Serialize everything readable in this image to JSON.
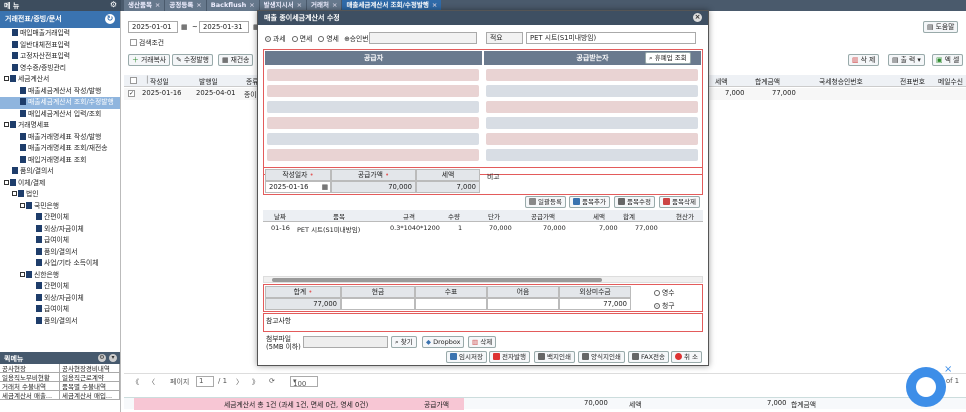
{
  "app": {
    "menu_label": "메 뉴"
  },
  "tabs": [
    {
      "label": "생산품목"
    },
    {
      "label": "공정등록"
    },
    {
      "label": "Backflush"
    },
    {
      "label": "발생지시서"
    },
    {
      "label": "거래처"
    },
    {
      "label": "매출세금계산서 조회/수정발행"
    }
  ],
  "sidebar": {
    "section_title": "거래전표/증빙/문서",
    "items": [
      {
        "label": "매입매출거래입력",
        "indent": 1,
        "icon": "doc"
      },
      {
        "label": "일반대체전표입력",
        "indent": 1,
        "icon": "doc"
      },
      {
        "label": "고정자산전표입력",
        "indent": 1,
        "icon": "doc"
      },
      {
        "label": "영수증/증빙관리",
        "indent": 1,
        "icon": "doc"
      },
      {
        "label": "세금계산서",
        "indent": 0,
        "icon": "fold"
      },
      {
        "label": "매출세금계산서 작성/발행",
        "indent": 2,
        "icon": "doc"
      },
      {
        "label": "매출세금계산서 조회/수정발행",
        "indent": 2,
        "icon": "doc",
        "selected": true
      },
      {
        "label": "매입세금계산서 입력/조회",
        "indent": 2,
        "icon": "doc"
      },
      {
        "label": "거래명세표",
        "indent": 0,
        "icon": "fold"
      },
      {
        "label": "매출거래명세표 작성/발행",
        "indent": 2,
        "icon": "doc"
      },
      {
        "label": "매출거래명세표 조회/재전송",
        "indent": 2,
        "icon": "doc"
      },
      {
        "label": "매입거래명세표 조회",
        "indent": 2,
        "icon": "doc"
      },
      {
        "label": "품의/결의서",
        "indent": 1,
        "icon": "doc"
      },
      {
        "label": "이체/결제",
        "indent": 0,
        "icon": "fold"
      },
      {
        "label": "법인",
        "indent": 1,
        "icon": "fold"
      },
      {
        "label": "국민은행",
        "indent": 2,
        "icon": "fold"
      },
      {
        "label": "간편이체",
        "indent": 4,
        "icon": "doc"
      },
      {
        "label": "외상/자금이체",
        "indent": 4,
        "icon": "doc"
      },
      {
        "label": "급여이체",
        "indent": 4,
        "icon": "doc"
      },
      {
        "label": "품의/결의서",
        "indent": 4,
        "icon": "doc"
      },
      {
        "label": "사업/기타 소득이체",
        "indent": 4,
        "icon": "doc"
      },
      {
        "label": "신한은행",
        "indent": 2,
        "icon": "fold"
      },
      {
        "label": "간편이체",
        "indent": 4,
        "icon": "doc"
      },
      {
        "label": "외상/자금이체",
        "indent": 4,
        "icon": "doc"
      },
      {
        "label": "급여이체",
        "indent": 4,
        "icon": "doc"
      },
      {
        "label": "품의/결의서",
        "indent": 4,
        "icon": "doc"
      }
    ]
  },
  "quickbar": {
    "title": "퀵메뉴",
    "cells": [
      "공사현장",
      "공사현장경비내역",
      "일용직노무비현황",
      "일용직근로계약",
      "거래처 수불내역",
      "품목별 수불내역",
      "세금계산서 매출...",
      "세금계산서 매입..."
    ]
  },
  "filter": {
    "date_from": "2025-01-01",
    "date_sep": "~",
    "date_to": "2025-01-31",
    "search_condition": "검색조건",
    "help": "도움말"
  },
  "toolbar": {
    "b1": "거래복사",
    "b2": "수정발행",
    "b3": "재건송",
    "delete": "삭 제",
    "print": "출 력",
    "excel": "엑 셀"
  },
  "grid": {
    "headers": [
      "작성일",
      "발행일",
      "종류"
    ],
    "right_headers": [
      "세액",
      "합계금액",
      "국세청승인번호",
      "전표번호",
      "메일수신"
    ],
    "row": {
      "date": "2025-01-16",
      "issue": "2025-04-01",
      "kind": "종이",
      "tax": "7,000",
      "total": "77,000"
    }
  },
  "pager": {
    "page_label": "페이지",
    "page": "1",
    "of": "/ 1",
    "size": "100"
  },
  "footer": {
    "summary": "세금계산서 총 1건 (과세 1건, 면세 0건, 영세 0건)",
    "supply_label": "공급가액",
    "supply": "70,000",
    "tax_label": "세액",
    "tax": "7,000",
    "total_label": "합계금액"
  },
  "modal": {
    "title": "매출 종이세금계산서 수정",
    "radio_tax": "과세",
    "radio_exempt": "면세",
    "radio_zero": "영세",
    "approval_label": "승인번호",
    "subject_label": "적요",
    "subject": "PET 시트(S1미내방임)",
    "supplier_band": "공급자",
    "buyer_band": "공급받는자",
    "lookup_btn": "휴폐업 조회",
    "write_date_label": "작성일자",
    "supply_label": "공급가액",
    "tax_label": "세액",
    "memo_label": "비고",
    "write_date": "2025-01-16",
    "supply": "70,000",
    "tax": "7,000",
    "item_btns": [
      "일괄등록",
      "품목추가",
      "품목수정",
      "품목삭제"
    ],
    "item_headers": [
      "날짜",
      "품목",
      "규격",
      "수량",
      "단가",
      "공급가액",
      "세액",
      "합계",
      "현산가"
    ],
    "item_row": [
      "01-16",
      "PET 시트(S1미내방임)",
      "0.3*1040*1200",
      "1",
      "70,000",
      "70,000",
      "7,000",
      "77,000",
      ""
    ],
    "sum_labels": [
      "합계",
      "현금",
      "수표",
      "어음",
      "외상미수금"
    ],
    "sum_total": "77,000",
    "sum_credit": "77,000",
    "receipt": "영수",
    "claim": "청구",
    "notes_label": "참고사항",
    "attach_label": "첨부파일\n(5MB 이하)",
    "attach_btns": [
      "찾기",
      "Dropbox",
      "삭제"
    ],
    "action_btns": [
      "임시저장",
      "전자발행",
      "백지인쇄",
      "양식지인쇄",
      "FAX전송",
      "취 소"
    ]
  },
  "fab": {
    "close": "×",
    "page": "of 1"
  },
  "colors": {
    "accent": "#3a73b0",
    "header": "#3e4f62",
    "red": "#e35b5b",
    "pink": "#f7c6d4"
  }
}
